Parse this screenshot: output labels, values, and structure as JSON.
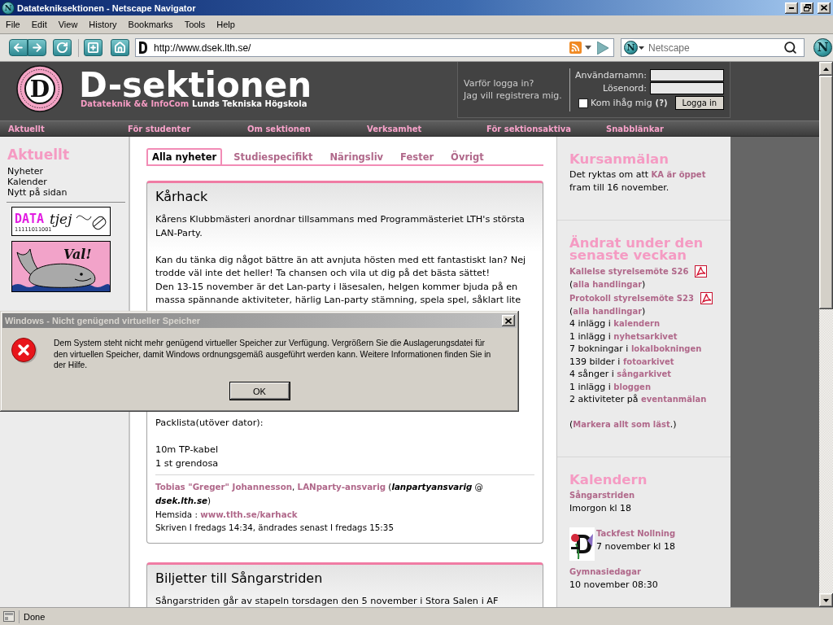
{
  "window": {
    "logo_letter": "N",
    "title": "Datatekniksektionen - Netscape Navigator"
  },
  "menu_bar": [
    "File",
    "Edit",
    "View",
    "History",
    "Bookmarks",
    "Tools",
    "Help"
  ],
  "toolbar": {
    "address": "http://www.dsek.lth.se/",
    "search": {
      "logo_letter": "N",
      "placeholder": "Netscape"
    },
    "throbber_letter": "N"
  },
  "page": {
    "header": {
      "logo_letter": "D",
      "title": "D-sektionen",
      "subtitle": [
        {
          "kind": "accent",
          "text": "Datateknik && InfoCom"
        },
        {
          "kind": "plain",
          "text": "Lunds Tekniska Högskola"
        }
      ]
    },
    "login": {
      "links": [
        "Varför logga in?",
        "Jag vill registrera mig."
      ],
      "fields": [
        {
          "label": "Användarnamn:"
        },
        {
          "label": "Lösenord:"
        }
      ],
      "remember": {
        "label": "Kom ihåg mig",
        "checked": false
      },
      "help": "(?)",
      "button": "Logga in"
    },
    "nav": [
      "Aktuellt",
      "För studenter",
      "Om sektionen",
      "Verksamhet",
      "För sektionsaktiva",
      "Snabblänkar"
    ],
    "left_sidebar": {
      "title": "Aktuellt",
      "links": [
        "Nyheter",
        "Kalender",
        "Nytt på sidan"
      ],
      "banners": [
        {
          "kind": "datatjej",
          "word": "DATA",
          "script": "tjej",
          "digits": "11111011001"
        },
        {
          "kind": "whale",
          "caption": "Val!"
        }
      ]
    },
    "main": {
      "tabs": [
        {
          "label": "Alla nyheter",
          "selected": true
        },
        {
          "label": "Studiespecifikt",
          "selected": false
        },
        {
          "label": "Näringsliv",
          "selected": false
        },
        {
          "label": "Fester",
          "selected": false
        },
        {
          "label": "Övrigt",
          "selected": false
        }
      ],
      "articles": [
        {
          "title": "Kårhack",
          "blocks": [
            {
              "kind": "paragraph",
              "lines": [
                "Kårens Klubbmästeri anordnar tillsammans med Programmästeriet LTH's största",
                "LAN-Party."
              ]
            },
            {
              "kind": "paragraph",
              "lines": [
                "Kan du tänka dig något bättre än att avnjuta hösten med ett fantastiskt lan? Nej",
                "trodde väl inte det heller! Ta chansen och vila ut dig på det bästa sättet!",
                "Den 13-15 november är det Lan-party i läsesalen, helgen kommer bjuda på en",
                "massa spännande aktiviteter, härlig Lan-party stämning, spela spel, såklart lite"
              ]
            },
            {
              "kind": "covered"
            },
            {
              "kind": "paragraph",
              "lines": [
                "Packlista(utöver dator):"
              ]
            },
            {
              "kind": "paragraph",
              "lines": [
                "10m TP-kabel",
                "1 st grendosa"
              ]
            }
          ],
          "signature": [
            {
              "kind": "link",
              "text": "Tobias \"Greger\" Johannesson"
            },
            {
              "kind": "text",
              "text": ", "
            },
            {
              "kind": "link",
              "text": "LANparty-ansvarig"
            },
            {
              "kind": "text",
              "text": " ("
            },
            {
              "kind": "email",
              "text": "lanpartyansvarig"
            },
            {
              "kind": "text",
              "text": " @ "
            },
            {
              "kind": "email",
              "text": "dsek.lth.se"
            },
            {
              "kind": "text",
              "text": ")"
            }
          ],
          "homepage": [
            {
              "kind": "text",
              "text": "Hemsida : "
            },
            {
              "kind": "link",
              "text": "www.tlth.se/karhack"
            }
          ],
          "timestamp": "Skriven I fredags 14:34, ändrades senast I fredags 15:35"
        },
        {
          "title": "Biljetter till Sångarstriden",
          "blocks": [
            {
              "kind": "paragraph",
              "lines": [
                "Sångarstriden går av stapeln torsdagen den 5 november i Stora Salen i AF"
              ]
            }
          ]
        }
      ]
    },
    "right_sidebar": {
      "sections": [
        {
          "kind": "notice",
          "title": "Kursanmälan",
          "parts": [
            {
              "kind": "text",
              "text": "Det ryktas om att "
            },
            {
              "kind": "link",
              "text": "KA är öppet"
            },
            {
              "kind": "text",
              "text": " fram till 16 november."
            }
          ]
        },
        {
          "kind": "changes",
          "title": "Ändrat under den senaste veckan",
          "items": [
            {
              "kind": "document",
              "parts": [
                {
                  "kind": "link",
                  "text": "Kallelse styrelsemöte S26"
                }
              ]
            },
            {
              "kind": "line",
              "parts": [
                {
                  "kind": "text",
                  "text": "("
                },
                {
                  "kind": "link",
                  "text": "alla handlingar"
                },
                {
                  "kind": "text",
                  "text": ")"
                }
              ]
            },
            {
              "kind": "document",
              "parts": [
                {
                  "kind": "link",
                  "text": "Protokoll styrelsemöte S23"
                }
              ]
            },
            {
              "kind": "line",
              "parts": [
                {
                  "kind": "text",
                  "text": "("
                },
                {
                  "kind": "link",
                  "text": "alla handlingar"
                },
                {
                  "kind": "text",
                  "text": ")"
                }
              ]
            },
            {
              "kind": "line",
              "parts": [
                {
                  "kind": "text",
                  "text": "4 inlägg i "
                },
                {
                  "kind": "link",
                  "text": "kalendern"
                }
              ]
            },
            {
              "kind": "line",
              "parts": [
                {
                  "kind": "text",
                  "text": "1 inlägg i "
                },
                {
                  "kind": "link",
                  "text": "nyhetsarkivet"
                }
              ]
            },
            {
              "kind": "line",
              "parts": [
                {
                  "kind": "text",
                  "text": "7 bokningar i "
                },
                {
                  "kind": "link",
                  "text": "lokalbokningen"
                }
              ]
            },
            {
              "kind": "line",
              "parts": [
                {
                  "kind": "text",
                  "text": "139 bilder i "
                },
                {
                  "kind": "link",
                  "text": "fotoarkivet"
                }
              ]
            },
            {
              "kind": "line",
              "parts": [
                {
                  "kind": "text",
                  "text": "4 sånger i "
                },
                {
                  "kind": "link",
                  "text": "sångarkivet"
                }
              ]
            },
            {
              "kind": "line",
              "parts": [
                {
                  "kind": "text",
                  "text": "1 inlägg i "
                },
                {
                  "kind": "link",
                  "text": "bloggen"
                }
              ]
            },
            {
              "kind": "line",
              "parts": [
                {
                  "kind": "text",
                  "text": "2 aktiviteter på "
                },
                {
                  "kind": "link",
                  "text": "eventanmälan"
                }
              ]
            }
          ],
          "footer": [
            {
              "kind": "text",
              "text": "("
            },
            {
              "kind": "link",
              "text": "Markera allt som läst"
            },
            {
              "kind": "text",
              "text": ".)"
            }
          ]
        },
        {
          "kind": "calendar",
          "title": "Kalendern",
          "events": [
            {
              "kind": "plain",
              "title": "Sångarstriden",
              "when": "Imorgon kl 18"
            },
            {
              "kind": "picture",
              "title": "Tackfest Nollning",
              "when": "7 november kl 18"
            },
            {
              "kind": "plain",
              "title": "Gymnasiedagar",
              "when": "10 november 08:30"
            }
          ]
        }
      ]
    }
  },
  "dialog": {
    "title": "Windows - Nicht genügend virtueller Speicher",
    "message_lines": [
      "Dem System steht nicht mehr genügend virtueller Speicher zur Verfügung. Vergrößern Sie die Auslagerungsdatei für",
      "den virtuellen Speicher, damit Windows ordnungsgemäß ausgeführt werden kann. Weitere Informationen finden Sie in",
      "der Hilfe."
    ],
    "button": "OK"
  },
  "status_bar": {
    "text": "Done"
  }
}
